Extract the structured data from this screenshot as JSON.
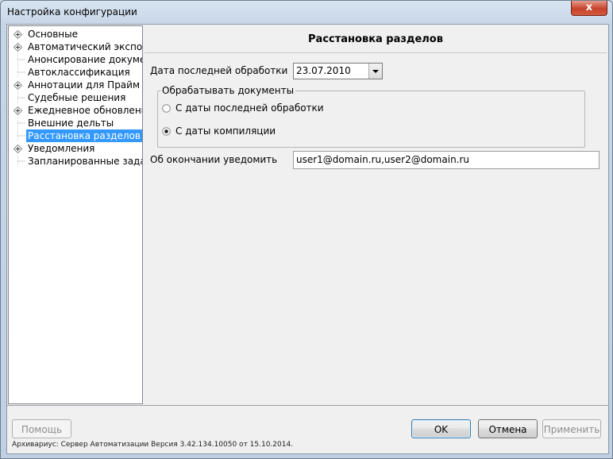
{
  "window": {
    "title": "Настройка конфигурации",
    "close_label": "x"
  },
  "tree": {
    "items": [
      {
        "label": "Основные",
        "expandable": true,
        "selected": false
      },
      {
        "label": "Автоматический экспорт",
        "expandable": true,
        "selected": false
      },
      {
        "label": "Анонсирование документов",
        "expandable": false,
        "selected": false
      },
      {
        "label": "Автоклассификация",
        "expandable": false,
        "selected": false
      },
      {
        "label": "Аннотации для Прайм",
        "expandable": true,
        "selected": false
      },
      {
        "label": "Судебные решения",
        "expandable": false,
        "selected": false
      },
      {
        "label": "Ежедневное обновление",
        "expandable": true,
        "selected": false
      },
      {
        "label": "Внешние дельты",
        "expandable": false,
        "selected": false
      },
      {
        "label": "Расстановка разделов",
        "expandable": false,
        "selected": true
      },
      {
        "label": "Уведомления",
        "expandable": true,
        "selected": false
      },
      {
        "label": "Запланированные задания",
        "expandable": false,
        "selected": false
      }
    ]
  },
  "panel": {
    "title": "Расстановка разделов",
    "last_processing_label": "Дата последней обработки",
    "last_processing_date": "23.07.2010",
    "group_label": "Обрабатывать документы",
    "radio_last_processing": "С даты последней обработки",
    "radio_compilation": "С даты компиляции",
    "selected_radio": "compilation",
    "notify_label": "Об окончании уведомить",
    "notify_value": "user1@domain.ru,user2@domain.ru"
  },
  "footer": {
    "help_label": "Помощь",
    "ok_label": "OK",
    "cancel_label": "Отмена",
    "apply_label": "Применить",
    "version_text": "Архивариус: Сервер Автоматизации Версия 3.42.134.10050 от 15.10.2014."
  },
  "colors": {
    "selection": "#3399ff",
    "close_button": "#c7432c"
  }
}
